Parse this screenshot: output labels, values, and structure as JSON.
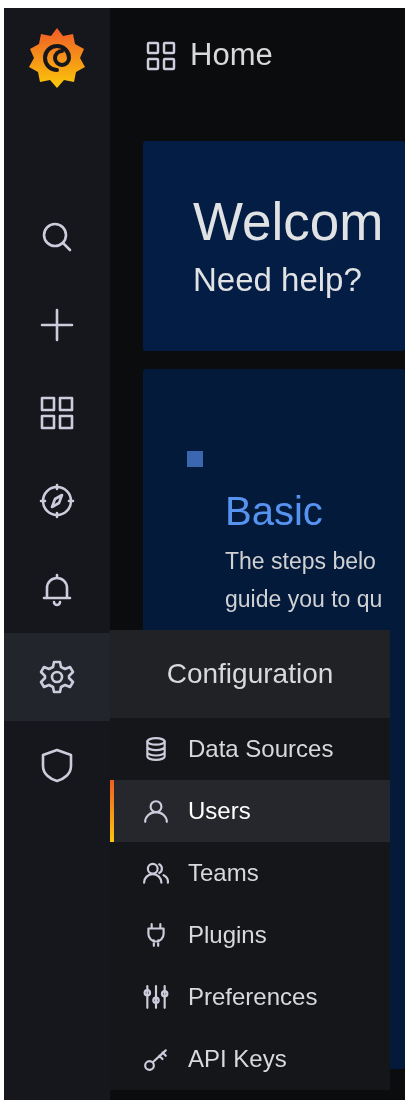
{
  "sidebar": {
    "items": [
      {
        "kind": "search",
        "selected": false
      },
      {
        "kind": "plus",
        "selected": false
      },
      {
        "kind": "grid",
        "selected": false
      },
      {
        "kind": "compass",
        "selected": false
      },
      {
        "kind": "bell",
        "selected": false
      },
      {
        "kind": "gear",
        "selected": true
      },
      {
        "kind": "shield",
        "selected": false
      }
    ]
  },
  "header": {
    "title": "Home"
  },
  "welcome": {
    "title": "Welcom",
    "subtitle": "Need help?"
  },
  "basic": {
    "title": "Basic",
    "lines": [
      "The steps belo",
      "guide you to qu"
    ]
  },
  "menu": {
    "title": "Configuration",
    "items": [
      {
        "label": "Data Sources",
        "kind": "database",
        "selected": false
      },
      {
        "label": "Users",
        "kind": "user",
        "selected": true
      },
      {
        "label": "Teams",
        "kind": "users",
        "selected": false
      },
      {
        "label": "Plugins",
        "kind": "plug",
        "selected": false
      },
      {
        "label": "Preferences",
        "kind": "sliders",
        "selected": false
      },
      {
        "label": "API Keys",
        "kind": "key",
        "selected": false
      }
    ]
  }
}
